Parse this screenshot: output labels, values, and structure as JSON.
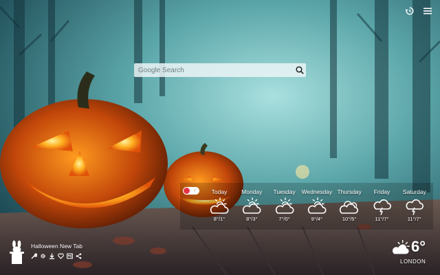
{
  "search": {
    "placeholder": "Google Search"
  },
  "weather": {
    "days": [
      {
        "name": "Today",
        "temp": "8°/1°",
        "icon": "partly-cloudy-icon"
      },
      {
        "name": "Monday",
        "temp": "8°/3°",
        "icon": "partly-cloudy-icon"
      },
      {
        "name": "Tuesday",
        "temp": "7°/0°",
        "icon": "partly-cloudy-icon"
      },
      {
        "name": "Wednesday",
        "temp": "9°/4°",
        "icon": "partly-cloudy-icon"
      },
      {
        "name": "Thursday",
        "temp": "10°/5°",
        "icon": "cloudy-icon"
      },
      {
        "name": "Friday",
        "temp": "11°/7°",
        "icon": "thunderstorm-icon"
      },
      {
        "name": "Saturday",
        "temp": "11°/7°",
        "icon": "thunderstorm-icon"
      }
    ],
    "current": {
      "temp": "6°",
      "city": "LONDON",
      "icon": "partly-cloudy-icon"
    }
  },
  "brand": {
    "title": "Halloween New Tab"
  },
  "colors": {
    "toggle_knob": "#e33446",
    "search_bg": "#ebf5f7"
  }
}
